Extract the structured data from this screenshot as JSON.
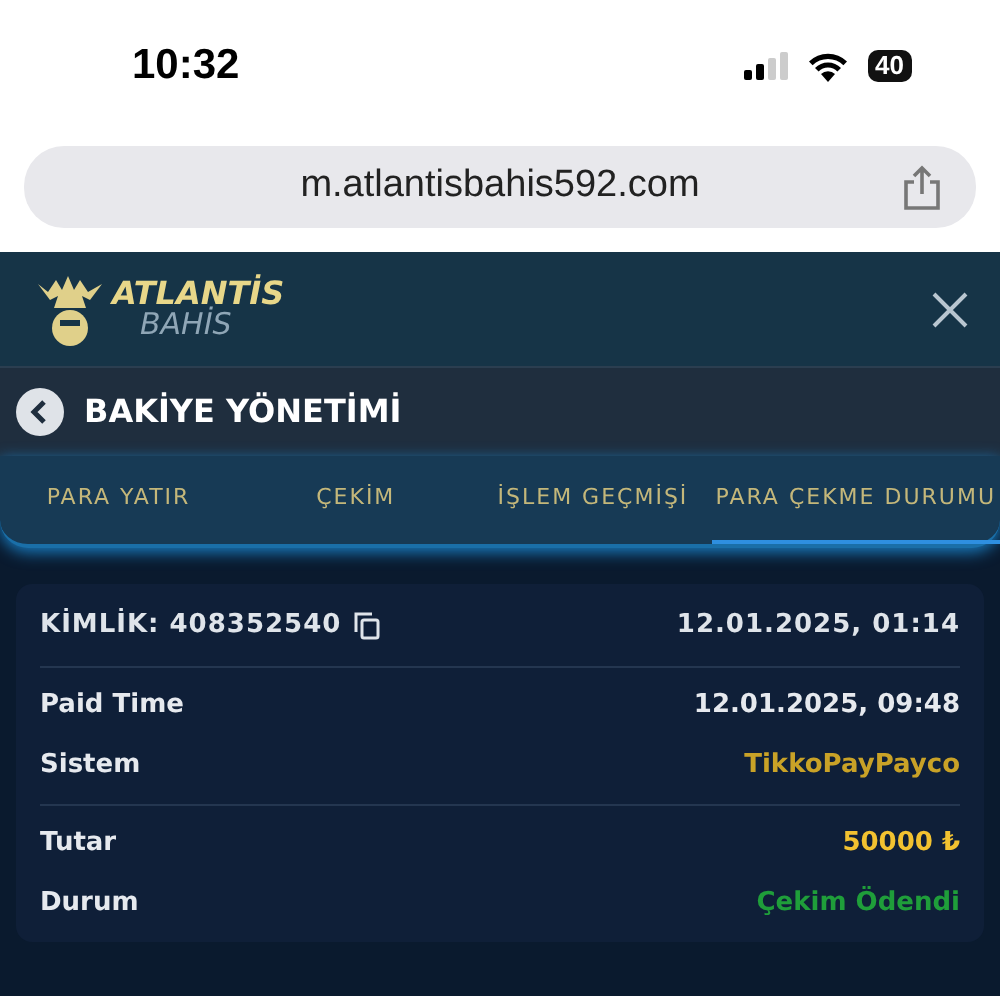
{
  "status_bar": {
    "time": "10:32",
    "battery": "40"
  },
  "browser": {
    "url": "m.atlantisbahis592.com"
  },
  "header": {
    "logo_top": "ATLANTİS",
    "logo_bottom": "BAHİS"
  },
  "page_title": "BAKİYE YÖNETİMİ",
  "tabs": [
    {
      "label": "PARA YATIR",
      "selected": false
    },
    {
      "label": "ÇEKİM",
      "selected": false
    },
    {
      "label": "İŞLEM GEÇMİŞİ",
      "selected": false
    },
    {
      "label": "PARA ÇEKME DURUMU",
      "selected": true
    }
  ],
  "card": {
    "id_label": "KİMLİK: 408352540",
    "date": "12.01.2025, 01:14",
    "groups": [
      [
        {
          "label": "Paid Time",
          "value": "12.01.2025, 09:48",
          "color": "#e6e9ee"
        },
        {
          "label": "Sistem",
          "value": "TikkoPayPayco",
          "color": "#c9a227"
        }
      ],
      [
        {
          "label": "Tutar",
          "value": "50000 ₺",
          "color": "#f2c230"
        },
        {
          "label": "Durum",
          "value": "Çekim Ödendi",
          "color": "#1f9e3a"
        }
      ]
    ]
  }
}
